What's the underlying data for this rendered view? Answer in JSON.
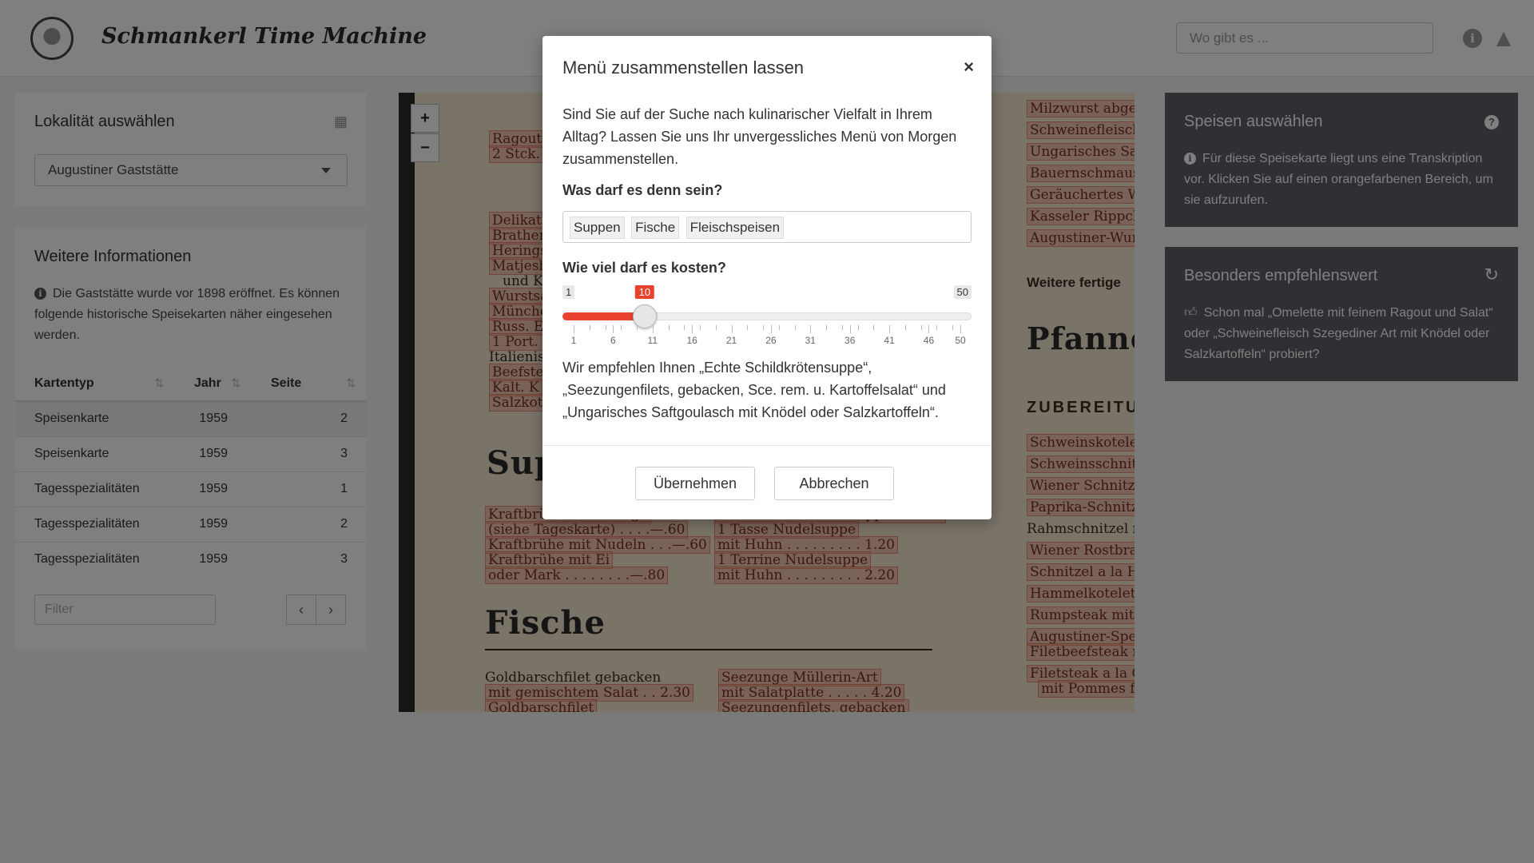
{
  "header": {
    "title": "Schmankerl Time Machine",
    "search_placeholder": "Wo gibt es ...",
    "info_icon": "info-icon",
    "gitlab_icon": "gitlab-icon"
  },
  "locality": {
    "title": "Lokalität auswählen",
    "selected": "Augustiner Gaststätte"
  },
  "info": {
    "title": "Weitere Informationen",
    "text": "Die Gaststätte wurde vor 1898 eröffnet. Es können folgende historische Speisekarten näher eingesehen werden.",
    "columns": [
      "Kartentyp",
      "Jahr",
      "Seite"
    ],
    "rows": [
      [
        "Speisenkarte",
        "1959",
        "2"
      ],
      [
        "Speisenkarte",
        "1959",
        "3"
      ],
      [
        "Tagesspezialitäten",
        "1959",
        "1"
      ],
      [
        "Tagesspezialitäten",
        "1959",
        "2"
      ],
      [
        "Tagesspezialitäten",
        "1959",
        "3"
      ]
    ],
    "filter_placeholder": "Filter",
    "prev": "‹",
    "next": "›"
  },
  "map": {
    "zoom_in": "+",
    "zoom_out": "−",
    "lines": [
      "Ragout",
      "2 Stck. fe",
      "Delikat",
      "Brather",
      "Herings",
      "Matjesh",
      "und K",
      "Wurstsa",
      "Münche",
      "Russ. Ei",
      "1 Port. C",
      "Italienis",
      "Beefstea",
      "Kalt. K",
      "Salzkote",
      "Supp",
      "Kraftbrühe mit Einlage",
      "(siehe Tageskarte) . . . .—.60",
      "Kraftbrühe mit Nudeln . . .—.60",
      "Kraftbrühe mit Ei",
      "oder Mark . . . . . . . .—.80",
      "Echte Schildkrötensuppe . . 1.20",
      "1 Tasse Nudelsuppe",
      "mit Huhn . . . . . . . . . 1.20",
      "1 Terrine Nudelsuppe",
      "mit Huhn . . . . . . . . . 2.20",
      "Fische",
      "Goldbarschfilet gebacken",
      "mit gemischtem Salat . . 2.30",
      "Goldbarschfilet",
      "Seezunge Müllerin-Art",
      "mit Salatplatte . . . . . 4.20",
      "Seezungenfilets, gebacken",
      "Milzwurst abgeb",
      "Schweinefleisch",
      "Ungarisches Saf",
      "Bauernschmaus",
      "Geräuchertes W",
      "Kasseler Rippch",
      "Augustiner-Wur",
      "Weitere fertige",
      "Pfanneng",
      "ZUBEREITU",
      "Schweinskotelett",
      "Schweinsschnitze",
      "Wiener Schnitze",
      "Paprika-Schnitze",
      "Rahmschnitzel m",
      "Wiener Rostbrat",
      "Schnitzel a la H",
      "Hammelkotelett",
      "Rumpsteak mit",
      "Augustiner-Spez",
      "Filetbeefsteak m",
      "Filetsteak a la C",
      "mit Pommes fr"
    ]
  },
  "speisen": {
    "title": "Speisen auswählen",
    "text": "Für diese Speisekarte liegt uns eine Transkription vor. Klicken Sie auf einen orangefarbenen Bereich, um sie aufzurufen."
  },
  "empfehlung": {
    "title": "Besonders empfehlenswert",
    "text": "Schon mal „Omelette mit feinem Ragout und Salat“ oder „Schweinefleisch Szegediner Art mit Knödel oder Salzkartoffeln“ probiert?"
  },
  "modal": {
    "title": "Menü zusammenstellen lassen",
    "close": "×",
    "intro": "Sind Sie auf der Suche nach kulinarischer Vielfalt in Ihrem Alltag? Lassen Sie uns Ihr unvergessliches Menü von Morgen zusammenstellen.",
    "question_food": "Was darf es denn sein?",
    "tags": [
      "Suppen",
      "Fische",
      "Fleischspeisen"
    ],
    "question_price": "Wie viel darf es kosten?",
    "slider": {
      "min": 1,
      "max": 50,
      "value": 10,
      "min_label": "1",
      "max_label": "50",
      "value_label": "10",
      "tick_labels": [
        "1",
        "6",
        "11",
        "16",
        "21",
        "26",
        "31",
        "36",
        "41",
        "46",
        "50"
      ]
    },
    "recommendation": "Wir empfehlen Ihnen „Echte Schildkrötensuppe“, „Seezungenfilets, gebacken, Sce. rem. u. Kartoffelsalat“ und „Ungarisches Saftgoulasch mit Knödel oder Salzkartoffeln“.",
    "apply": "Übernehmen",
    "cancel": "Abbrechen"
  }
}
